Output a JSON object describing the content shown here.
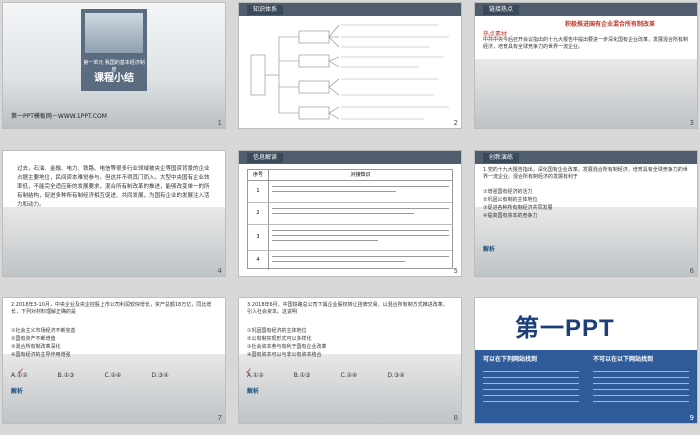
{
  "slides": [
    {
      "num": "1",
      "title_small": "第一单元  我国的基本经济制度",
      "title": "课程小结",
      "footer": "第一PPT模板网－WWW.1PPT.COM"
    },
    {
      "num": "2",
      "header": "知识体系"
    },
    {
      "num": "3",
      "header": "链接热点",
      "headline": "积极推进国有企业混合所有制改革",
      "sub": "热点素材",
      "body": "中共中央今后召开会议指出的十九大报告中提出要进一步深化国有企业改革，发展混合所有制经济，培育具有全球竞争力的世界一流企业。"
    },
    {
      "num": "4",
      "body": "过去，石油、金融、电力、铁路、电信等很多行业领域被央企等国资背景的企业占据主要地位，民间资本难觉参与，但这并不得其门而入。大型中央国有企业效率低，不能完全适应新的发展要求，混合所有制改革的推进，能够改变单一的所有制结构，促进多种所有制经济相互促进、共同发展，为国有企业的发展注入活力和动力。"
    },
    {
      "num": "5",
      "header": "信息解读",
      "col1": "序号",
      "col2": "对接知识",
      "rows": [
        "1",
        "2",
        "3",
        "4"
      ]
    },
    {
      "num": "6",
      "header": "创新演练",
      "q": "1.党的十九大报告指出，深化国有企业改革，发展混合所有制经济，培育具有全球竞争力的世界一流企业。混合所有制经济的发展有利于",
      "opts": [
        "①增强国有经济的活力",
        "②巩固公有制的主体地位",
        "③促进各种所有制经济共同发展",
        "④提高国有资本的竞争力"
      ],
      "answer_label": "解析"
    },
    {
      "num": "7",
      "q": "2.2018年3-10月，中央企业及央企控股上市公司利润较快增长，资产总额18万亿，同比增长，下列对材料理解正确的是",
      "opts": [
        "①社会主义市场经济不断完善",
        "②国有资产不断增值",
        "③混合所有制改革深化",
        "④国有经济的主导作用增强"
      ],
      "answer_choices": [
        "A.①②",
        "B.①③",
        "C.②④",
        "D.③④"
      ],
      "answer_label": "解析"
    },
    {
      "num": "8",
      "q": "3.2018年6月，中国铁路总公司下属企业股权转让挂牌交易，以混合所有制方式推进改革，引入社会资本。这说明",
      "opts": [
        "①巩固国有经济的主体地位",
        "②公有制实现形式可以多样化",
        "③社会资本参与有利于国有企业改革",
        "④国有资本可以与非公有资本结合"
      ],
      "answer_choices": [
        "A.①②",
        "B.①③",
        "C.②④",
        "D.③④"
      ],
      "answer_label": "解析"
    },
    {
      "num": "9",
      "logo": "第一PPT",
      "left_title": "可以在下列网站找到",
      "right_title": "不可以在以下网站找到"
    }
  ]
}
